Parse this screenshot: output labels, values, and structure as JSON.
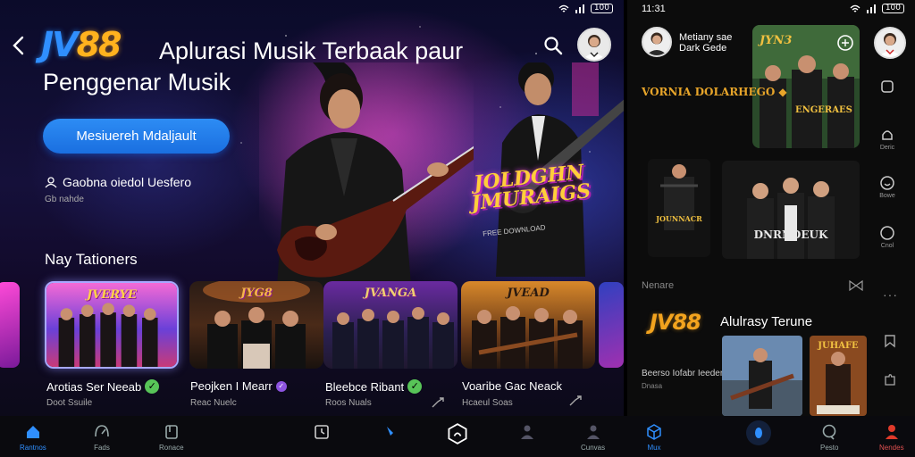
{
  "colors": {
    "accent": "#2f8fff",
    "gold": "#f2a31e",
    "bg_dark": "#0c0c0c"
  },
  "left": {
    "status": {
      "battery": "100"
    },
    "logo": {
      "jv": "JV",
      "num": "88"
    },
    "title": "Aplurasi Musik Terbaak paur Penggenar Musik",
    "cta_label": "Mesiuereh Mdaljault",
    "meta_text": "Gaobna oiedol Uesfero",
    "meta_sub": "Gb nahde",
    "poster_title": "JOLDGHN JMURAIGS",
    "poster_sub": "FREE DOWNLOAD",
    "section_title": "Nay Tationers",
    "cards": [
      {
        "art_title": "JVERYE",
        "label": "Arotias Ser Neeab",
        "sub": "Doot Ssuile",
        "badge": "✓"
      },
      {
        "art_title": "JYG8",
        "label": "Peojken I Mearr",
        "sub": "Reac Nuelc",
        "badge": "✓"
      },
      {
        "art_title": "JVANGA",
        "label": "Bleebce Ribant",
        "sub": "Roos Nuals",
        "badge": "✓"
      },
      {
        "art_title": "JVEAD",
        "label": "Voaribe Gac Neack",
        "sub": "Hcaeul Soas"
      }
    ]
  },
  "bottom_nav": [
    {
      "label": "Rantnos",
      "icon": "home-icon",
      "active": true
    },
    {
      "label": "Fads",
      "icon": "gauge-icon"
    },
    {
      "label": "Ronace",
      "icon": "library-icon"
    },
    {
      "label": "",
      "icon": "clock-icon"
    },
    {
      "label": "",
      "icon": "note-icon"
    },
    {
      "label": "",
      "icon": "play-hex-icon"
    },
    {
      "label": "",
      "icon": "person-icon"
    },
    {
      "label": "Cunvas",
      "icon": "profile-icon"
    },
    {
      "label": "Mux",
      "icon": "cube-icon",
      "active": true
    },
    {
      "label": "",
      "icon": "mic-icon"
    },
    {
      "label": "Pesto",
      "icon": "chat-icon"
    },
    {
      "label": "Nendes",
      "icon": "user-icon"
    }
  ],
  "right": {
    "time": "11:31",
    "battery": "100",
    "artist_name": "Metiany sae",
    "artist_sub": "Dark Gede",
    "card1_title": "JYN3",
    "card1_caption": "ENGERAES",
    "gold_title": "VORNIA DOLARHEGO",
    "side_items": [
      {
        "label": "",
        "icon": "home-outline-icon"
      },
      {
        "label": "Deric",
        "icon": "bell-icon"
      },
      {
        "label": "Bowe",
        "icon": "smile-icon"
      },
      {
        "label": "Cnol",
        "icon": "power-icon"
      }
    ],
    "card2_title": "JOUNNACR",
    "card3_title": "DNRNDEUK",
    "section": "Nenare",
    "logo": "JV88",
    "app_title": "Alulrasy Terune",
    "desc": "Beerso Iofabr Ieeder",
    "desc_sub": "Dnasa",
    "card5_title": "JUHAFE"
  }
}
